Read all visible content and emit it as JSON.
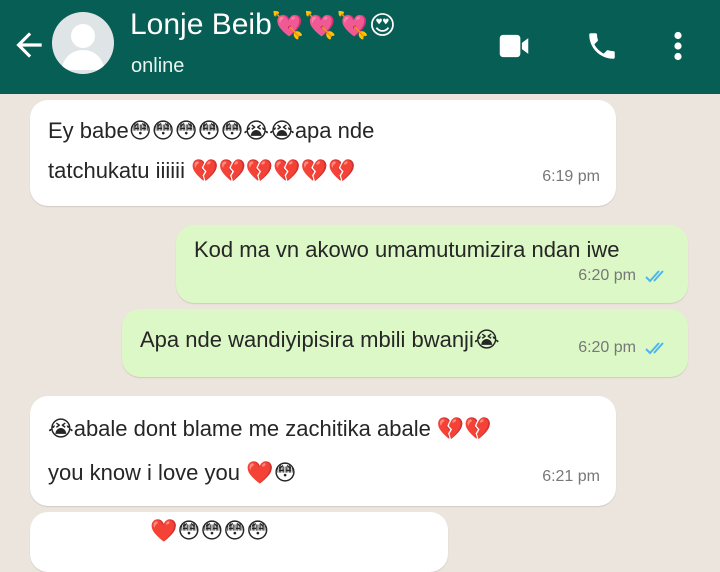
{
  "header": {
    "contact_name": "Lonje Beib",
    "name_emojis": "💘💘💘😍",
    "status": "online",
    "color": "#075e54"
  },
  "icons": [
    "back-arrow-icon",
    "avatar-icon",
    "video-call-icon",
    "phone-icon",
    "more-vert-icon",
    "double-check-icon"
  ],
  "messages": [
    {
      "dir": "in",
      "line1": "Ey babe😳😳😳😳😳😭😭apa nde",
      "line2": "tatchukatu iiiiii 💔💔💔💔💔💔",
      "time": "6:19 pm"
    },
    {
      "dir": "out",
      "line1": "Kod ma vn akowo umamutumizira ndan iwe",
      "time": "6:20 pm"
    },
    {
      "dir": "out",
      "line1": "Apa nde wandiyipisira mbili bwanji😭",
      "time": "6:20 pm"
    },
    {
      "dir": "in",
      "line1": "😭abale dont blame me zachitika abale 💔💔",
      "line2": "you know i love you ❤️😳",
      "time": "6:21 pm"
    },
    {
      "dir": "in",
      "line1": "❤️😳😳😳😳"
    }
  ]
}
